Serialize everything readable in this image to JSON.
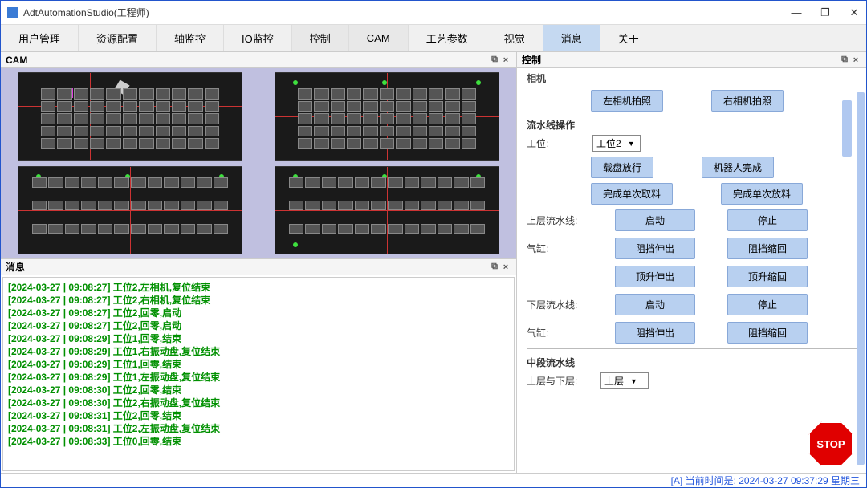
{
  "window": {
    "title": "AdtAutomationStudio(工程师)",
    "minimize": "—",
    "maximize": "❐",
    "close": "✕"
  },
  "menu": {
    "items": [
      "用户管理",
      "资源配置",
      "轴监控",
      "IO监控",
      "控制",
      "CAM",
      "工艺参数",
      "视觉",
      "消息",
      "关于"
    ],
    "activeIndexes": [
      4,
      5,
      8
    ]
  },
  "panels": {
    "cam": {
      "title": "CAM",
      "dock": "⧉",
      "close": "×"
    },
    "msg": {
      "title": "消息",
      "dock": "⧉",
      "close": "×"
    },
    "ctrl": {
      "title": "控制",
      "dock": "⧉",
      "close": "×"
    }
  },
  "messages": [
    "[2024-03-27 | 09:08:27]  工位2,左相机,复位结束",
    "[2024-03-27 | 09:08:27]  工位2,右相机,复位结束",
    "[2024-03-27 | 09:08:27]  工位2,回零,启动",
    "[2024-03-27 | 09:08:27]  工位2,回零,启动",
    "[2024-03-27 | 09:08:29]  工位1,回零,结束",
    "[2024-03-27 | 09:08:29]  工位1,右振动盘,复位结束",
    "[2024-03-27 | 09:08:29]  工位1,回零,结束",
    "[2024-03-27 | 09:08:29]  工位1,左振动盘,复位结束",
    "[2024-03-27 | 09:08:30]  工位2,回零,结束",
    "[2024-03-27 | 09:08:30]  工位2,右振动盘,复位结束",
    "[2024-03-27 | 09:08:31]  工位2,回零,结束",
    "[2024-03-27 | 09:08:31]  工位2,左振动盘,复位结束",
    "[2024-03-27 | 09:08:33]  工位0,回零,结束"
  ],
  "control": {
    "head_cut": "相机",
    "left_photo": "左相机拍照",
    "right_photo": "右相机拍照",
    "line_ops": "流水线操作",
    "station_label": "工位:",
    "station_value": "工位2",
    "tray_release": "载盘放行",
    "robot_done": "机器人完成",
    "single_pick_done": "完成单次取料",
    "single_place_done": "完成单次放料",
    "upper_line": "上层流水线:",
    "start": "启动",
    "stop": "停止",
    "cylinder": "气缸:",
    "block_extend": "阻挡伸出",
    "block_retract": "阻挡缩回",
    "lift_extend": "顶升伸出",
    "lift_retract": "顶升缩回",
    "lower_line": "下层流水线:",
    "mid_line": "中段流水线",
    "layer_label": "上层与下层:",
    "layer_value": "上层",
    "stop_btn": "STOP"
  },
  "statusbar": {
    "text": "[A] 当前时间是:  2024-03-27 09:37:29 星期三"
  }
}
